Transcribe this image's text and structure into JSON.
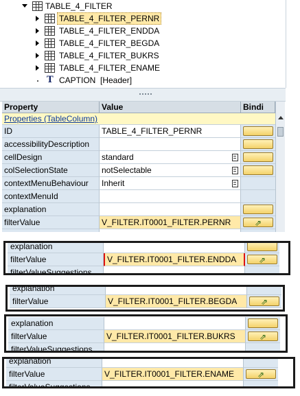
{
  "tree": {
    "root": "TABLE_4_FILTER",
    "children": [
      "TABLE_4_FILTER_PERNR",
      "TABLE_4_FILTER_ENDDA",
      "TABLE_4_FILTER_BEGDA",
      "TABLE_4_FILTER_BUKRS",
      "TABLE_4_FILTER_ENAME"
    ],
    "caption_label": "CAPTION",
    "caption_suffix": "[Header]"
  },
  "grid": {
    "headers": {
      "property": "Property",
      "value": "Value",
      "binding": "Bindi"
    },
    "section": "Properties (TableColumn)",
    "rows": [
      {
        "property": "ID",
        "value": "TABLE_4_FILTER_PERNR",
        "bind_button": true
      },
      {
        "property": "accessibilityDescription",
        "value": "",
        "bind_button": true
      },
      {
        "property": "cellDesign",
        "value": "standard",
        "bind_button": true,
        "dropdown": true
      },
      {
        "property": "colSelectionState",
        "value": "notSelectable",
        "bind_button": true,
        "dropdown": true
      },
      {
        "property": "contextMenuBehaviour",
        "value": "Inherit",
        "bind_button": false,
        "dropdown": true
      },
      {
        "property": "contextMenuId",
        "value": "",
        "bind_button": false
      },
      {
        "property": "explanation",
        "value": "",
        "bind_button": true
      },
      {
        "property": "filterValue",
        "value": "V_FILTER.IT0001_FILTER.PERNR",
        "bind_button": true,
        "bound": true,
        "highlight": true
      },
      {
        "property": "filterValueSuggestions",
        "value": "",
        "bind_button": false
      }
    ]
  },
  "snippets": [
    {
      "top_label": "explanation",
      "property": "filterValue",
      "value": "V_FILTER.IT0001_FILTER.ENDDA",
      "bottom_label": "filterValueSuggestions"
    },
    {
      "top_label": "explanation",
      "property": "filterValue",
      "value": "V_FILTER.IT0001_FILTER.BEGDA",
      "bottom_label": ""
    },
    {
      "top_label": "explanation",
      "property": "filterValue",
      "value": "V_FILTER.IT0001_FILTER.BUKRS",
      "bottom_label": "filterValueSuggestions"
    },
    {
      "top_label": "explanation",
      "property": "filterValue",
      "value": "V_FILTER.IT0001_FILTER.ENAME",
      "bottom_label": "filterValueSuggestions"
    }
  ],
  "icons": {
    "table": "table-icon",
    "text": "text-element-icon",
    "binding": "binding-icon",
    "value_help": "value-help-icon"
  },
  "colors": {
    "selection": "#ffe9a8",
    "property_cell": "#dce7f1",
    "header": "#d6dee5",
    "section": "#fff8c4",
    "snippet_border": "#1a1a1a"
  }
}
